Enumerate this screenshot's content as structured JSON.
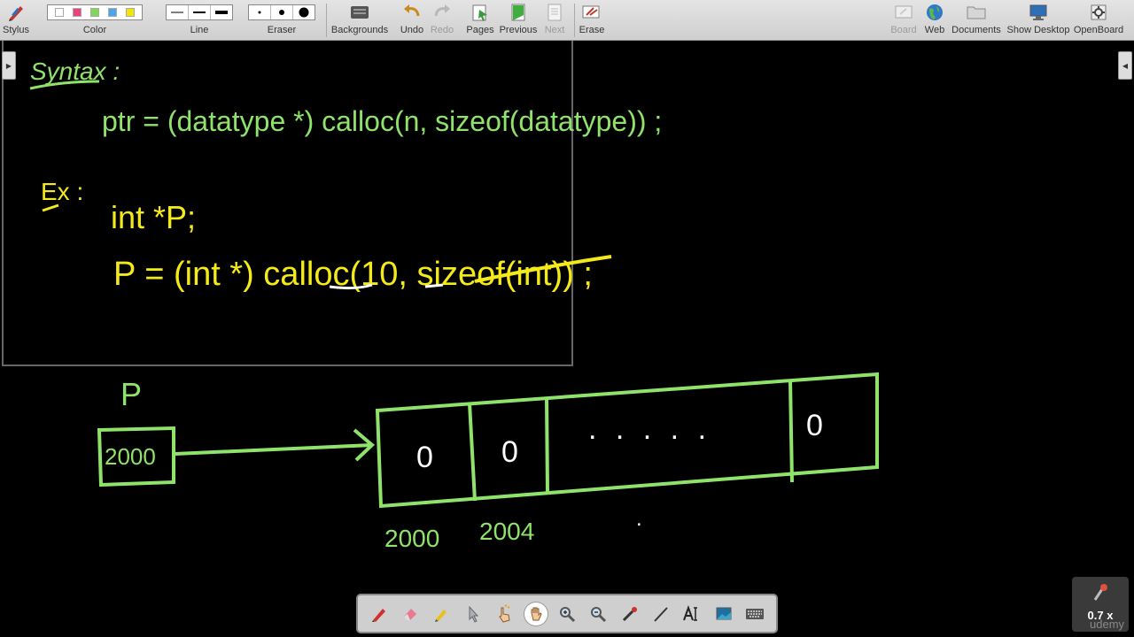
{
  "toolbar": {
    "stylus": "Stylus",
    "color": "Color",
    "line": "Line",
    "eraser": "Eraser",
    "backgrounds": "Backgrounds",
    "undo": "Undo",
    "redo": "Redo",
    "pages": "Pages",
    "previous": "Previous",
    "next": "Next",
    "erase": "Erase",
    "board": "Board",
    "web": "Web",
    "documents": "Documents",
    "show_desktop": "Show Desktop",
    "openboard": "OpenBoard",
    "swatch_colors": [
      "#ffffff",
      "#e8457a",
      "#7ed957",
      "#4aa8e8",
      "#f2e600"
    ]
  },
  "board": {
    "syntax_label": "Syntax :",
    "syntax_code": "ptr = (datatype *) calloc(n, sizeof(datatype)) ;",
    "example_label": "Ex :",
    "example_decl": "int *P;",
    "example_call": "P = (int *) calloc(10, sizeof(int)) ;",
    "pointer_name": "P",
    "pointer_value": "2000",
    "cells": [
      "0",
      "0",
      ". . . . .",
      "0"
    ],
    "addresses": [
      "2000",
      "2004"
    ],
    "stray_dot": "."
  },
  "colors": {
    "green_ink": "#8fe36a",
    "yellow_ink": "#f4ea1a",
    "white_ink": "#ffffff",
    "board_bg": "#000000"
  },
  "zoom": {
    "label": "0.7 x"
  },
  "watermark": "udemy"
}
